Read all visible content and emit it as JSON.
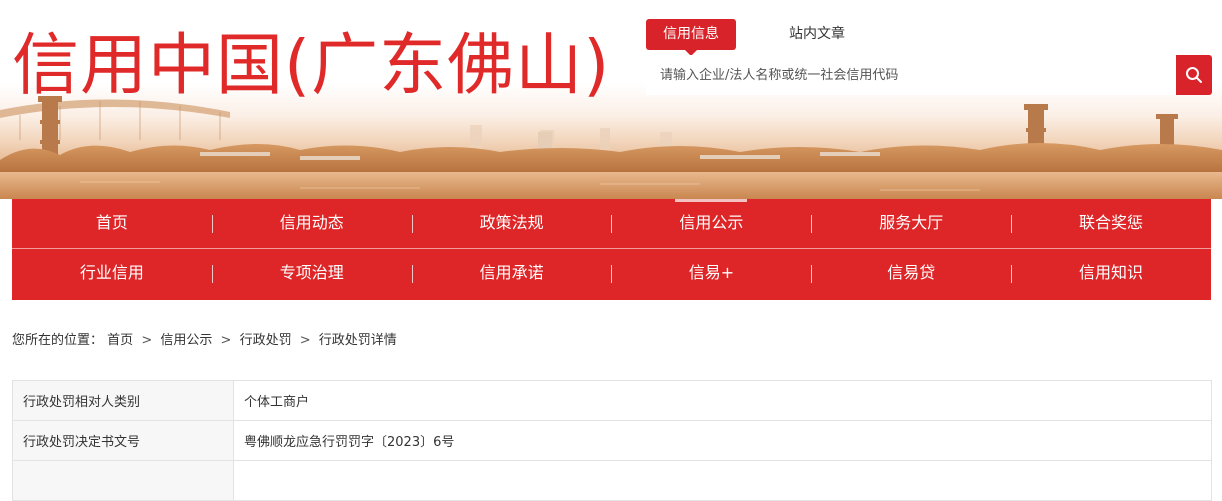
{
  "site": {
    "title": "信用中国(广东佛山)"
  },
  "search": {
    "tabs": [
      {
        "label": "信用信息",
        "active": true
      },
      {
        "label": "站内文章",
        "active": false
      }
    ],
    "placeholder": "请输入企业/法人名称或统一社会信用代码",
    "value": "",
    "button_icon": "search-icon"
  },
  "nav": {
    "row1": [
      {
        "label": "首页"
      },
      {
        "label": "信用动态"
      },
      {
        "label": "政策法规"
      },
      {
        "label": "信用公示",
        "active": true
      },
      {
        "label": "服务大厅"
      },
      {
        "label": "联合奖惩"
      }
    ],
    "row2": [
      {
        "label": "行业信用"
      },
      {
        "label": "专项治理"
      },
      {
        "label": "信用承诺"
      },
      {
        "label": "信易+"
      },
      {
        "label": "信易贷"
      },
      {
        "label": "信用知识"
      }
    ]
  },
  "breadcrumb": {
    "prefix": "您所在的位置：",
    "items": [
      "首页",
      "信用公示",
      "行政处罚",
      "行政处罚详情"
    ],
    "separator": ">"
  },
  "details": [
    {
      "label": "行政处罚相对人类别",
      "value": "个体工商户"
    },
    {
      "label": "行政处罚决定书文号",
      "value": "粤佛顺龙应急行罚罚字〔2023〕6号"
    },
    {
      "label": "",
      "value": ""
    }
  ],
  "colors": {
    "brand_red": "#de2527",
    "title_red": "#e02a2a"
  }
}
